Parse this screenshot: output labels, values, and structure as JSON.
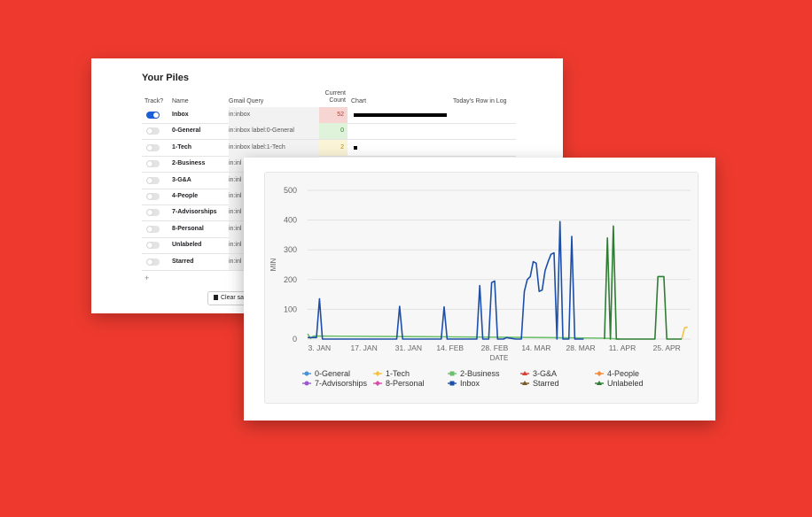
{
  "piles": {
    "title": "Your Piles",
    "headers": {
      "track": "Track?",
      "name": "Name",
      "query": "Gmail Query",
      "count_line1": "Current",
      "count_line2": "Count",
      "chart": "Chart",
      "today": "Today's Row in Log"
    },
    "rows": [
      {
        "name": "Inbox",
        "query": "in:inbox",
        "count": "52",
        "tracked": true
      },
      {
        "name": "0-General",
        "query": "in:inbox label:0-General",
        "count": "0",
        "tracked": false
      },
      {
        "name": "1-Tech",
        "query": "in:inbox label:1-Tech",
        "count": "2",
        "tracked": false
      },
      {
        "name": "2-Business",
        "query": "in:inl",
        "count": "",
        "tracked": false
      },
      {
        "name": "3-G&A",
        "query": "in:inl",
        "count": "",
        "tracked": false
      },
      {
        "name": "4-People",
        "query": "in:inl",
        "count": "",
        "tracked": false
      },
      {
        "name": "7-Advisorships",
        "query": "in:inl",
        "count": "",
        "tracked": false
      },
      {
        "name": "8-Personal",
        "query": "in:inl",
        "count": "",
        "tracked": false
      },
      {
        "name": "Unlabeled",
        "query": "in:inl",
        "count": "",
        "tracked": false
      },
      {
        "name": "Starred",
        "query": "in:inl",
        "count": "",
        "tracked": false
      }
    ],
    "add_label": "+",
    "clear_label": "Clear sa",
    "count_colors": {
      "inbox": "#f6d5d2",
      "general": "#dff3da",
      "tech": "#fbf4d6"
    }
  },
  "chart_data": {
    "type": "line",
    "xlabel": "DATE",
    "ylabel": "MIN",
    "ylim": [
      0,
      500
    ],
    "yticks": [
      "0",
      "100",
      "200",
      "300",
      "400",
      "500"
    ],
    "xticks": [
      "3. JAN",
      "17. JAN",
      "31. JAN",
      "14. FEB",
      "28. FEB",
      "14. MAR",
      "28. MAR",
      "11. APR",
      "25. APR"
    ],
    "grid": true,
    "legend_position": "bottom",
    "series": [
      {
        "name": "0-General",
        "color": "#4a90d9",
        "marker": "circle",
        "values": []
      },
      {
        "name": "1-Tech",
        "color": "#f5c242",
        "marker": "diamond",
        "values": [
          [
            126,
            0
          ],
          [
            127,
            38
          ],
          [
            128,
            40
          ]
        ]
      },
      {
        "name": "2-Business",
        "color": "#6cc06c",
        "marker": "square",
        "values": [
          [
            0,
            18
          ],
          [
            1,
            2
          ],
          [
            2,
            10
          ],
          [
            40,
            8
          ],
          [
            80,
            5
          ],
          [
            100,
            3
          ],
          [
            105,
            0
          ]
        ]
      },
      {
        "name": "3-G&A",
        "color": "#d9403a",
        "marker": "triangle",
        "values": []
      },
      {
        "name": "4-People",
        "color": "#f28c3a",
        "marker": "diamond",
        "values": []
      },
      {
        "name": "7-Advisorships",
        "color": "#9b59d0",
        "marker": "circle",
        "values": []
      },
      {
        "name": "8-Personal",
        "color": "#d94aa8",
        "marker": "diamond",
        "values": []
      },
      {
        "name": "Inbox",
        "color": "#1d4fa8",
        "marker": "square",
        "values": [
          [
            0,
            5
          ],
          [
            3,
            5
          ],
          [
            4,
            135
          ],
          [
            5,
            0
          ],
          [
            30,
            0
          ],
          [
            31,
            110
          ],
          [
            32,
            0
          ],
          [
            45,
            0
          ],
          [
            46,
            108
          ],
          [
            47,
            0
          ],
          [
            57,
            0
          ],
          [
            58,
            180
          ],
          [
            59,
            0
          ],
          [
            61,
            0
          ],
          [
            62,
            190
          ],
          [
            63,
            195
          ],
          [
            64,
            0
          ],
          [
            66,
            0
          ],
          [
            67,
            5
          ],
          [
            70,
            0
          ],
          [
            72,
            0
          ],
          [
            73,
            160
          ],
          [
            74,
            200
          ],
          [
            75,
            210
          ],
          [
            76,
            260
          ],
          [
            77,
            255
          ],
          [
            78,
            160
          ],
          [
            79,
            165
          ],
          [
            80,
            230
          ],
          [
            81,
            260
          ],
          [
            82,
            285
          ],
          [
            83,
            290
          ],
          [
            84,
            0
          ],
          [
            85,
            395
          ],
          [
            86,
            0
          ],
          [
            88,
            0
          ],
          [
            89,
            345
          ],
          [
            90,
            0
          ],
          [
            93,
            0
          ]
        ]
      },
      {
        "name": "Starred",
        "color": "#7a5a2a",
        "marker": "triangle",
        "values": []
      },
      {
        "name": "Unlabeled",
        "color": "#2e7d32",
        "marker": "triangle",
        "values": [
          [
            100,
            0
          ],
          [
            101,
            340
          ],
          [
            102,
            0
          ],
          [
            103,
            380
          ],
          [
            104,
            0
          ],
          [
            105,
            0
          ],
          [
            117,
            0
          ],
          [
            118,
            210
          ],
          [
            120,
            210
          ],
          [
            121,
            0
          ],
          [
            126,
            0
          ]
        ]
      }
    ]
  }
}
